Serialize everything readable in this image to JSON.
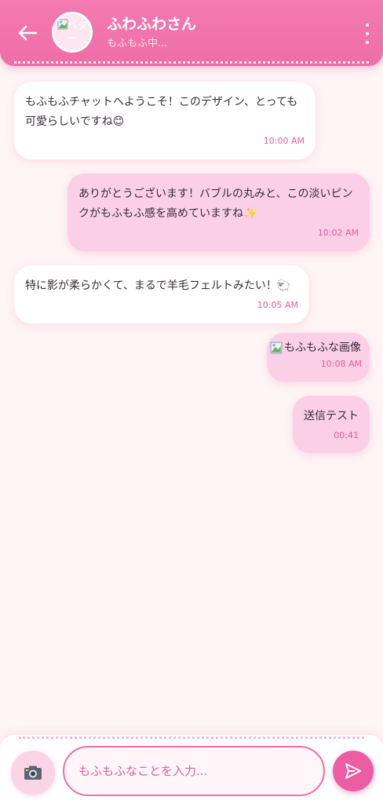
{
  "header": {
    "chat_name": "ふわふわさん",
    "status": "もふもふ中...",
    "avatar_alt": "アバター",
    "back_icon": "arrow-left-icon",
    "menu_icon": "vertical-dots-icon"
  },
  "messages": [
    {
      "side": "received",
      "text": "もふもふチャットへようこそ！このデザイン、とっても可愛らしいですね",
      "emoji": "😊",
      "time": "10:00 AM"
    },
    {
      "side": "sent",
      "text": "ありがとうございます！バブルの丸みと、この淡いピンクがもふもふ感を高めていますね",
      "emoji": "✨",
      "time": "10:02 AM"
    },
    {
      "side": "received",
      "text": "特に影が柔らかくて、まるで羊毛フェルトみたい！",
      "emoji": "🐑",
      "time": "10:05 AM"
    },
    {
      "side": "sent",
      "type": "image",
      "image_alt": "もふもふな画像",
      "time": "10:08 AM"
    },
    {
      "side": "sent",
      "text": "送信テスト",
      "time": "00:41"
    }
  ],
  "input": {
    "placeholder": "もふもふなことを入力...",
    "value": "",
    "camera_icon": "camera-icon",
    "send_icon": "send-icon"
  },
  "colors": {
    "accent": "#ee6ea6",
    "sent_bubble": "#fbcfe6",
    "received_bubble": "#ffffff",
    "background": "#fff4f6",
    "time_text": "#e0609c"
  }
}
